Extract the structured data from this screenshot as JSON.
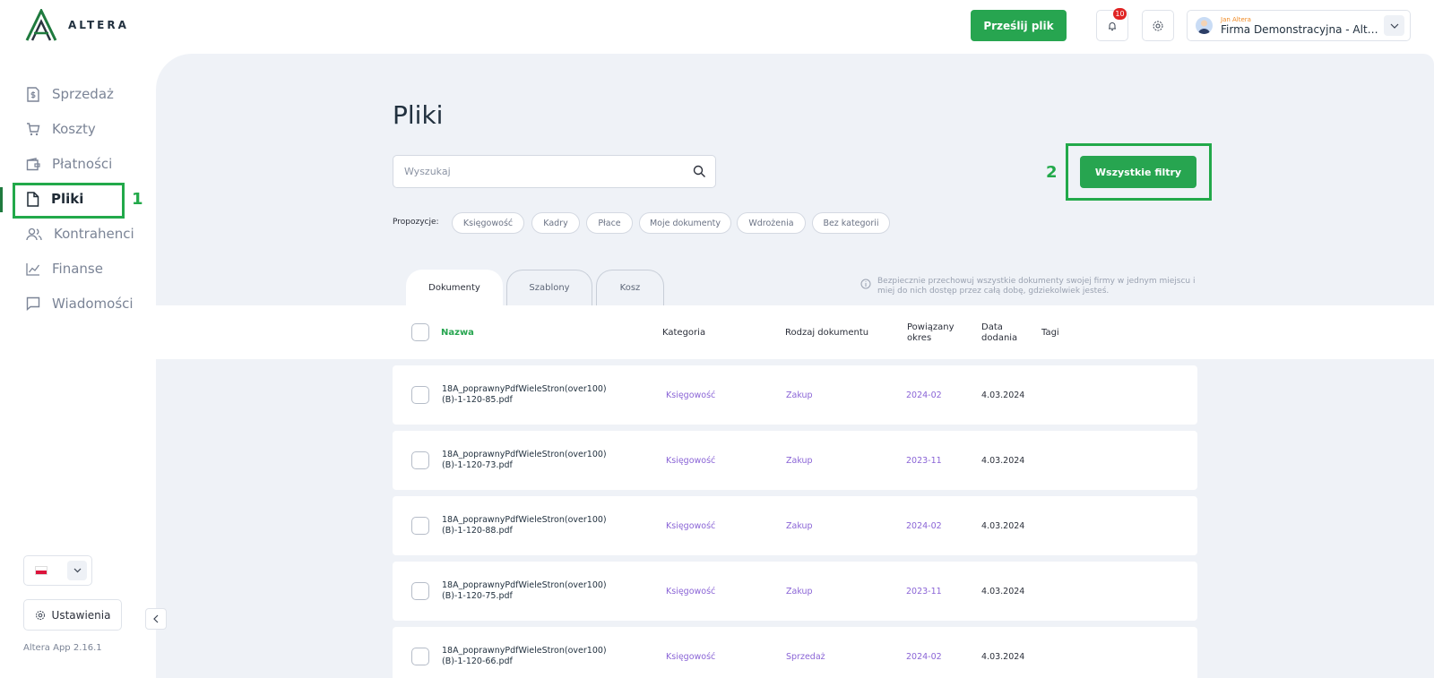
{
  "brand": {
    "name": "ALTERA"
  },
  "header": {
    "upload_label": "Prześlij plik",
    "notifications_count": "10",
    "user": {
      "name": "Jan Altera",
      "company": "Firma Demonstracyjna - Altera"
    }
  },
  "sidebar": {
    "items": [
      {
        "label": "Sprzedaż",
        "icon": "dollar-doc-icon"
      },
      {
        "label": "Koszty",
        "icon": "cart-icon"
      },
      {
        "label": "Płatności",
        "icon": "wallet-icon"
      },
      {
        "label": "Pliki",
        "icon": "file-icon"
      },
      {
        "label": "Kontrahenci",
        "icon": "users-icon"
      },
      {
        "label": "Finanse",
        "icon": "chart-line-icon"
      },
      {
        "label": "Wiadomości",
        "icon": "message-icon"
      }
    ],
    "active": "Pliki",
    "settings_label": "Ustawienia",
    "version": "Altera App 2.16.1"
  },
  "annotations": {
    "first": "1",
    "second": "2"
  },
  "main": {
    "title": "Pliki",
    "search_placeholder": "Wyszukaj",
    "filters_label": "Wszystkie filtry",
    "suggestions_label": "Propozycje:",
    "suggestions": [
      "Księgowość",
      "Kadry",
      "Płace",
      "Moje dokumenty",
      "Wdrożenia",
      "Bez kategorii"
    ],
    "tabs": [
      "Dokumenty",
      "Szablony",
      "Kosz"
    ],
    "info_text": "Bezpiecznie przechowuj wszystkie dokumenty swojej firmy w jednym miejscu i miej do nich dostęp przez całą dobę, gdziekolwiek jesteś.",
    "columns": {
      "name": "Nazwa",
      "category": "Kategoria",
      "doc_type": "Rodzaj dokumentu",
      "period_1": "Powiązany",
      "period_2": "okres",
      "date_1": "Data",
      "date_2": "dodania",
      "tags": "Tagi"
    },
    "rows": [
      {
        "name_1": "18A_poprawnyPdfWieleStron(over100)",
        "name_2": "(B)-1-120-85.pdf",
        "category": "Księgowość",
        "doc_type": "Zakup",
        "period": "2024-02",
        "date": "4.03.2024"
      },
      {
        "name_1": "18A_poprawnyPdfWieleStron(over100)",
        "name_2": "(B)-1-120-73.pdf",
        "category": "Księgowość",
        "doc_type": "Zakup",
        "period": "2023-11",
        "date": "4.03.2024"
      },
      {
        "name_1": "18A_poprawnyPdfWieleStron(over100)",
        "name_2": "(B)-1-120-88.pdf",
        "category": "Księgowość",
        "doc_type": "Zakup",
        "period": "2024-02",
        "date": "4.03.2024"
      },
      {
        "name_1": "18A_poprawnyPdfWieleStron(over100)",
        "name_2": "(B)-1-120-75.pdf",
        "category": "Księgowość",
        "doc_type": "Zakup",
        "period": "2023-11",
        "date": "4.03.2024"
      },
      {
        "name_1": "18A_poprawnyPdfWieleStron(over100)",
        "name_2": "(B)-1-120-66.pdf",
        "category": "Księgowość",
        "doc_type": "Sprzedaż",
        "period": "2024-02",
        "date": "4.03.2024"
      }
    ]
  },
  "colors": {
    "accent": "#27a550",
    "highlight": "#22a94a",
    "link": "#8a64d6",
    "badge": "#e02424"
  }
}
